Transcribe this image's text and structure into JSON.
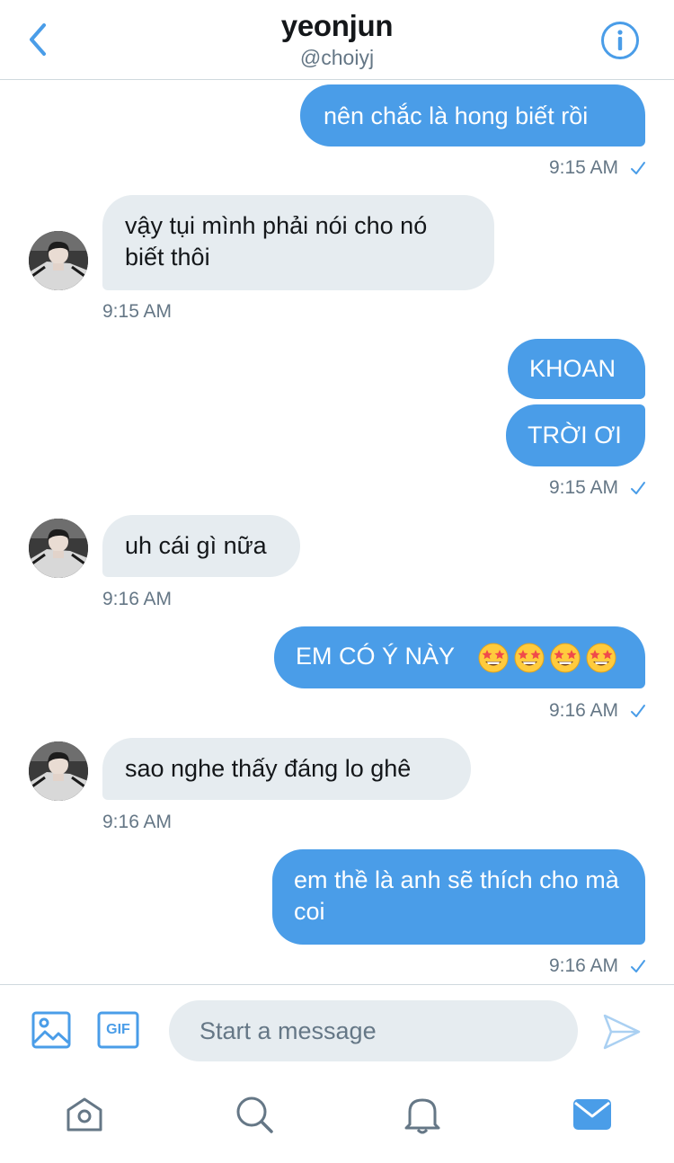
{
  "header": {
    "title": "yeonjun",
    "handle": "@choiyj",
    "back_icon": "chevron-left-icon",
    "info_icon": "info-icon",
    "accent": "#4a9de8"
  },
  "messages": [
    {
      "direction": "out",
      "text": "nên chắc là hong biết rồi",
      "time": "9:15 AM"
    },
    {
      "direction": "in",
      "text": "vậy tụi mình phải nói cho nó biết thôi",
      "time": "9:15 AM"
    },
    {
      "direction": "out",
      "text": "KHOAN"
    },
    {
      "direction": "out",
      "text": "TRỜI ƠI",
      "time": "9:15 AM"
    },
    {
      "direction": "in",
      "text": "uh cái gì nữa",
      "time": "9:16 AM"
    },
    {
      "direction": "out",
      "text": "EM CÓ Ý NÀY 🤩🤩🤩🤩",
      "time": "9:16 AM"
    },
    {
      "direction": "in",
      "text": "sao nghe thấy đáng lo ghê",
      "time": "9:16 AM"
    },
    {
      "direction": "out",
      "text": "em thề là anh sẽ thích cho mà coi",
      "time": "9:16 AM"
    }
  ],
  "composer": {
    "placeholder": "Start a message",
    "media_icon": "image-icon",
    "gif_label": "GIF",
    "send_icon": "send-icon"
  },
  "tabs": [
    {
      "name": "home",
      "icon": "home-icon"
    },
    {
      "name": "search",
      "icon": "search-icon"
    },
    {
      "name": "notifications",
      "icon": "bell-icon"
    },
    {
      "name": "messages",
      "icon": "mail-icon",
      "active": true
    }
  ],
  "colors": {
    "outgoing_bubble": "#4a9de8",
    "incoming_bubble": "#e6ecf0",
    "timestamp": "#657786"
  }
}
